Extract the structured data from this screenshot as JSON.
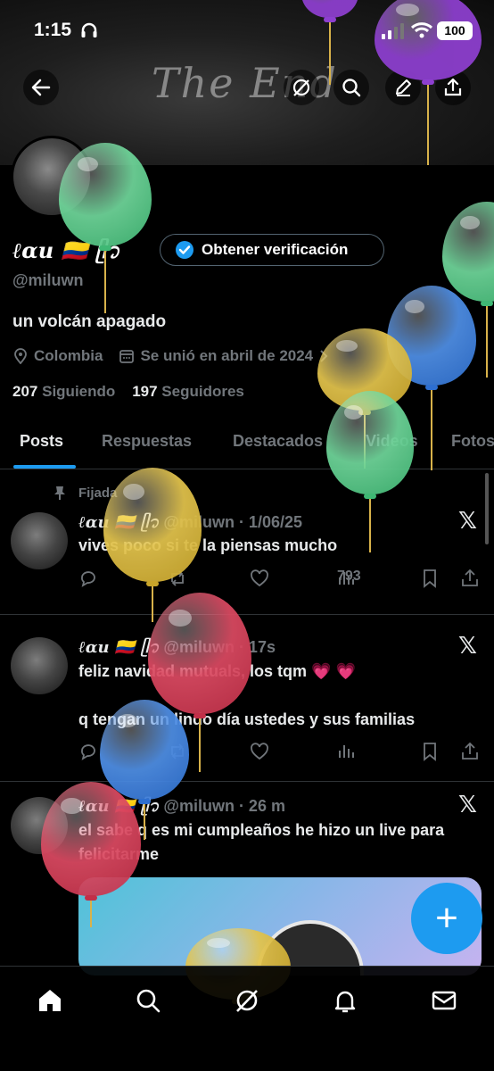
{
  "status_bar": {
    "time": "1:15",
    "battery": "100"
  },
  "banner": {
    "text": "The End"
  },
  "profile": {
    "name": "ℓαu 🇨🇴 ᥫ᭡",
    "verify_label": "Obtener verificación",
    "handle": "@miluwn",
    "bio": "un volcán apagado",
    "location": "Colombia",
    "joined": "Se unió en abril de 2024",
    "following_count": "207",
    "following_label": "Siguiendo",
    "followers_count": "197",
    "followers_label": "Seguidores"
  },
  "tabs": [
    {
      "label": "Posts"
    },
    {
      "label": "Respuestas"
    },
    {
      "label": "Destacados"
    },
    {
      "label": "Videos"
    },
    {
      "label": "Fotos"
    }
  ],
  "posts": [
    {
      "pinned_label": "Fijada",
      "author": "ℓαu 🇨🇴 ᥫ᭡",
      "handle_time": "@miluwn · 1/06/25",
      "text": "vives poco si te la piensas mucho",
      "views": "793"
    },
    {
      "author": "ℓαu 🇨🇴 ᥫ᭡",
      "handle_time": "@miluwn · 17s",
      "text": "feliz navidad mutuals, los tqm 💗 💗\n\nq tengan un lindo día ustedes y sus familias"
    },
    {
      "author": "ℓαu 🇨🇴 ᥫ᭡",
      "handle_time": "@miluwn · 26 m",
      "text": "el sabe q es mi cumpleaños he hizo un live para felicitarme"
    }
  ],
  "fab": {
    "label": "+"
  },
  "colors": {
    "accent": "#1d9bf0",
    "background": "#000000",
    "muted": "#71767b"
  }
}
